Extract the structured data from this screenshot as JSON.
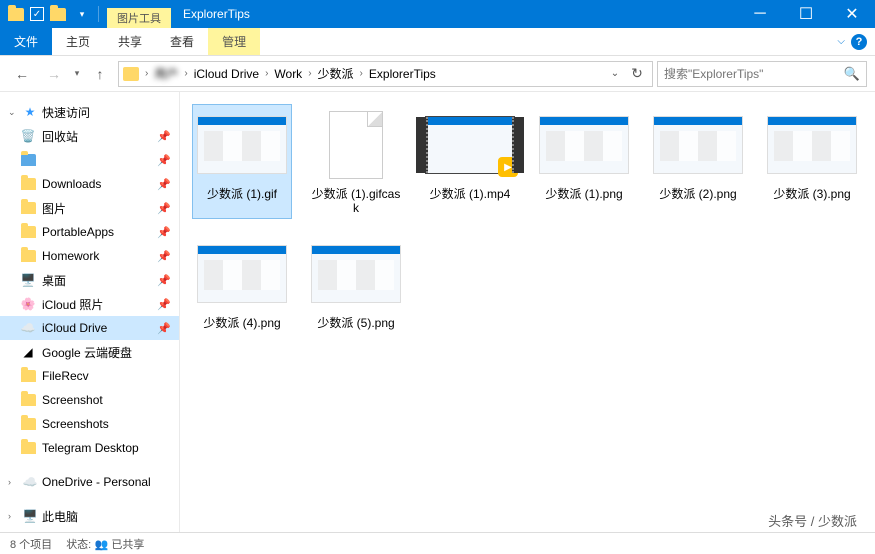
{
  "titlebar": {
    "tools_label": "图片工具",
    "title": "ExplorerTips"
  },
  "ribbon": {
    "file": "文件",
    "home": "主页",
    "share": "共享",
    "view": "查看",
    "manage": "管理"
  },
  "breadcrumb": {
    "hidden_label": "用户",
    "items": [
      "iCloud Drive",
      "Work",
      "少数派",
      "ExplorerTips"
    ]
  },
  "search": {
    "placeholder": "搜索\"ExplorerTips\""
  },
  "sidebar": {
    "quick_access": "快速访问",
    "recycle": "回收站",
    "downloads": "Downloads",
    "pictures": "图片",
    "portable": "PortableApps",
    "homework": "Homework",
    "desktop": "桌面",
    "icloud_photo": "iCloud 照片",
    "icloud_drive": "iCloud Drive",
    "google": "Google 云端硬盘",
    "filerecv": "FileRecv",
    "screenshot": "Screenshot",
    "screenshots": "Screenshots",
    "telegram": "Telegram Desktop",
    "onedrive": "OneDrive - Personal",
    "thispc": "此电脑"
  },
  "files": [
    {
      "name": "少数派 (1).gif",
      "type": "img",
      "selected": true
    },
    {
      "name": "少数派 (1).gifcask",
      "type": "doc"
    },
    {
      "name": "少数派 (1).mp4",
      "type": "video"
    },
    {
      "name": "少数派 (1).png",
      "type": "img"
    },
    {
      "name": "少数派 (2).png",
      "type": "img"
    },
    {
      "name": "少数派 (3).png",
      "type": "img"
    },
    {
      "name": "少数派 (4).png",
      "type": "img"
    },
    {
      "name": "少数派 (5).png",
      "type": "img"
    }
  ],
  "status": {
    "count": "8 个项目",
    "state_label": "状态:",
    "shared": "已共享"
  },
  "watermark": "头条号 / 少数派"
}
